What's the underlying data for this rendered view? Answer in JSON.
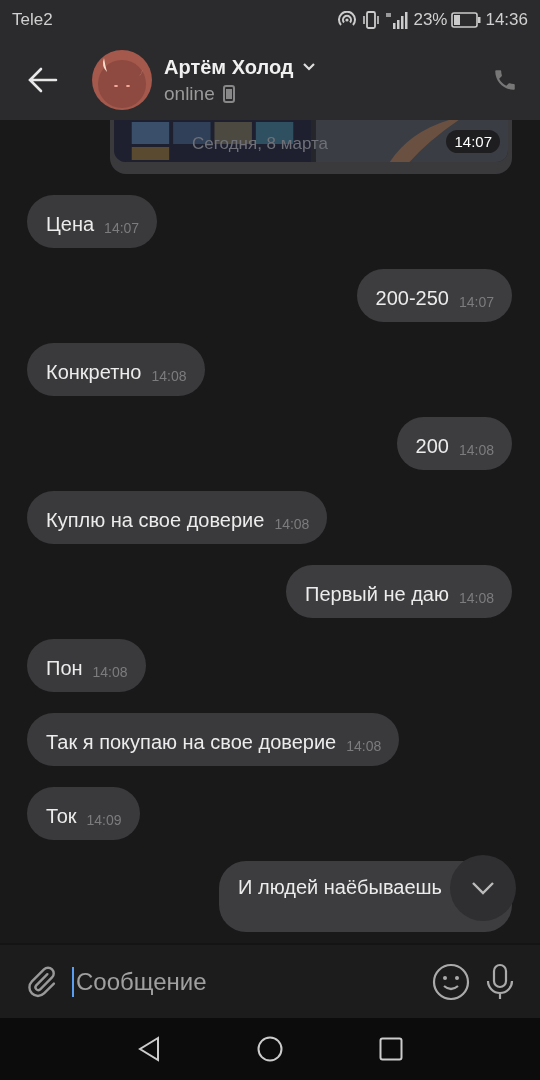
{
  "status_bar": {
    "carrier": "Tele2",
    "battery": "23%",
    "time": "14:36"
  },
  "header": {
    "name": "Артём Холод",
    "status": "online"
  },
  "photo_message": {
    "date_badge": "Сегодня, 8 марта",
    "time": "14:07"
  },
  "messages": [
    {
      "text": "Цена",
      "time": "14:07",
      "outgoing": false
    },
    {
      "text": "200-250",
      "time": "14:07",
      "outgoing": true
    },
    {
      "text": "Конкретно",
      "time": "14:08",
      "outgoing": false
    },
    {
      "text": "200",
      "time": "14:08",
      "outgoing": true
    },
    {
      "text": "Куплю на свое доверие",
      "time": "14:08",
      "outgoing": false
    },
    {
      "text": "Первый не даю",
      "time": "14:08",
      "outgoing": true
    },
    {
      "text": "Пон",
      "time": "14:08",
      "outgoing": false
    },
    {
      "text": "Так я покупаю на свое доверие",
      "time": "14:08",
      "outgoing": false
    },
    {
      "text": "Ток",
      "time": "14:09",
      "outgoing": false
    },
    {
      "text": "И людей наёбываешь",
      "outgoing": true
    }
  ],
  "composer": {
    "placeholder": "Сообщение"
  }
}
